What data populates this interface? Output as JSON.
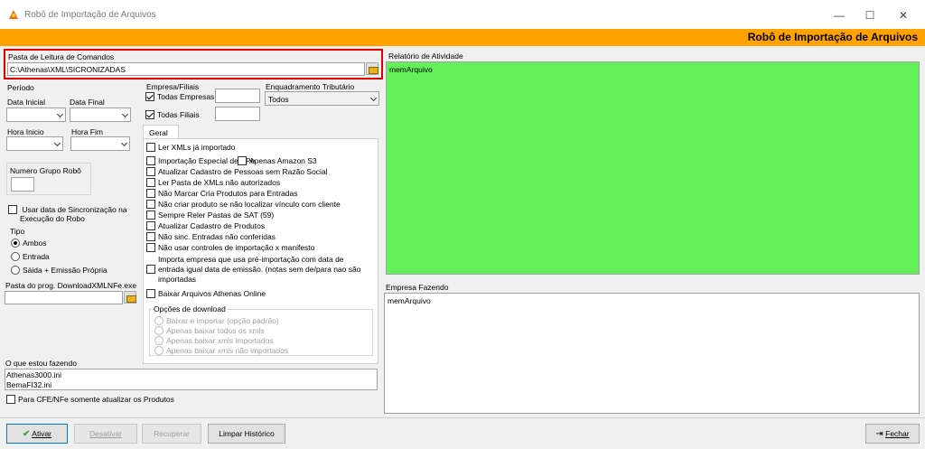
{
  "window": {
    "title": "Robô de Importação de Arquivos",
    "minimize": "—",
    "maximize": "☐",
    "close": "✕"
  },
  "banner": {
    "title": "Robô de Importação de Arquivos"
  },
  "pasta": {
    "label": "Pasta de Leitura de Comandos",
    "value": "C:\\Athenas\\XML\\SICRONIZADAS"
  },
  "periodo": {
    "label": "Período",
    "data_inicial": "Data Inicial",
    "data_final": "Data Final",
    "hora_inicio": "Hora Inicio",
    "hora_fim": "Hora Fim"
  },
  "numero_grupo": {
    "label": "Numero Grupo Robô",
    "value": ""
  },
  "usar_data": {
    "label_1": "Usar data de Sincronização na",
    "label_2": "Execução do Robo"
  },
  "tipo": {
    "label": "Tipo",
    "options": [
      "Ambos",
      "Entrada",
      "Sáida + Emissão Própria"
    ],
    "selected": "Ambos"
  },
  "pasta_prog": {
    "label": "Pasta do prog. DownloadXMLNFe.exe",
    "value": ""
  },
  "empresa": {
    "label": "Empresa/Filiais",
    "todas_empresas": "Todas Empresas",
    "todas_filiais": "Todas Filiais"
  },
  "enquadramento": {
    "label": "Enquadramento Tributário",
    "value": "Todos"
  },
  "geral": {
    "tab": "Geral",
    "options": [
      "Ler XMLs já importado",
      "Importação Especial de BPe",
      "Atualizar Cadastro de Pessoas sem Razão Social",
      "Ler Pasta de XMLs não autorizados",
      "Não Marcar Cria Produtos para Entradas",
      "Não criar produto se não localizar vínculo com cliente",
      "Sempre Reler Pastas de SAT (59)",
      "Atualizar Cadastro de Produtos",
      "Não sinc. Entradas não conferidas",
      "Não usar controles de importação x manifesto"
    ],
    "amazon": "Apenas Amazon S3",
    "importa_1": "Importa empresa que usa pré-importação com data de",
    "importa_2": "entrada igual data de emissão. (notas sem de/para nao são",
    "importa_3": "importadas",
    "baixar_online": "Baixar Arquivos Athenas Online",
    "download": {
      "label": "Opções de download",
      "options": [
        "Baixar e importar (opção padrão)",
        "Apenas baixar todos os xmls",
        "Apenas baixar xmls importados",
        "Apenas baixar xmls não importados"
      ]
    }
  },
  "relatorio": {
    "label": "Relatório de Atividade",
    "content": "memArquivo",
    "bg": "#64f05a"
  },
  "empresa_fazendo": {
    "label": "Empresa Fazendo",
    "content": "memArquivo"
  },
  "oque": {
    "label": "O que estou fazendo",
    "line1": "Athenas3000.ini",
    "line2": "BemaFI32.ini"
  },
  "cfe": {
    "label": "Para CFE/NFe  somente atualizar os Produtos"
  },
  "buttons": {
    "ativar": "Ativar",
    "desativar": "Desativar",
    "recuperar": "Recuperar",
    "limpar": "Limpar Histórico",
    "fechar": "Fechar"
  },
  "colors": {
    "banner": "#ffa200",
    "highlight": "#e00000"
  }
}
